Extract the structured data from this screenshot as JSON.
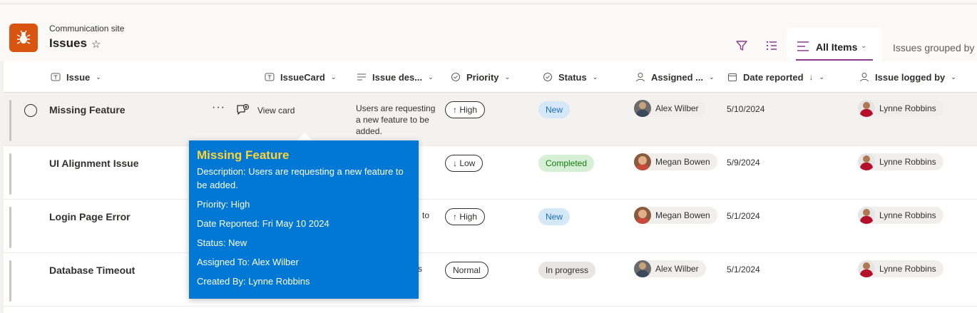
{
  "site": {
    "name": "Communication site",
    "list_title": "Issues"
  },
  "views": {
    "active": "All Items",
    "other": "Issues grouped by"
  },
  "columns": {
    "issue": "Issue",
    "issue_card": "IssueCard",
    "description": "Issue des...",
    "priority": "Priority",
    "status": "Status",
    "assigned": "Assigned ...",
    "date_reported": "Date reported",
    "logged_by": "Issue logged by"
  },
  "row_actions": {
    "view_card": "View card"
  },
  "rows": [
    {
      "title": "Missing Feature",
      "description": "Users are requesting a new feature to be added.",
      "priority": "↑ High",
      "status": "New",
      "assigned": "Alex Wilber",
      "date": "5/10/2024",
      "logged_by": "Lynne Robbins"
    },
    {
      "title": "UI Alignment Issue",
      "description": "",
      "priority": "↓ Low",
      "status": "Completed",
      "assigned": "Megan Bowen",
      "date": "5/9/2024",
      "logged_by": "Lynne Robbins"
    },
    {
      "title": "Login Page Error",
      "description": "to",
      "priority": "↑ High",
      "status": "New",
      "assigned": "Megan Bowen",
      "date": "5/1/2024",
      "logged_by": "Lynne Robbins"
    },
    {
      "title": "Database Timeout",
      "description": "s",
      "priority": "Normal",
      "status": "In progress",
      "assigned": "Alex Wilber",
      "date": "5/1/2024",
      "logged_by": "Lynne Robbins"
    }
  ],
  "card": {
    "title": "Missing Feature",
    "description": "Description: Users are requesting a new feature to be added.",
    "priority": "Priority: High",
    "date_reported": "Date Reported: Fri May 10 2024",
    "status": "Status: New",
    "assigned_to": "Assigned To: Alex Wilber",
    "created_by": "Created By: Lynne Robbins"
  },
  "colors": {
    "accent": "#0078d4",
    "card_title": "#ffd335",
    "logo": "#d9540f"
  }
}
